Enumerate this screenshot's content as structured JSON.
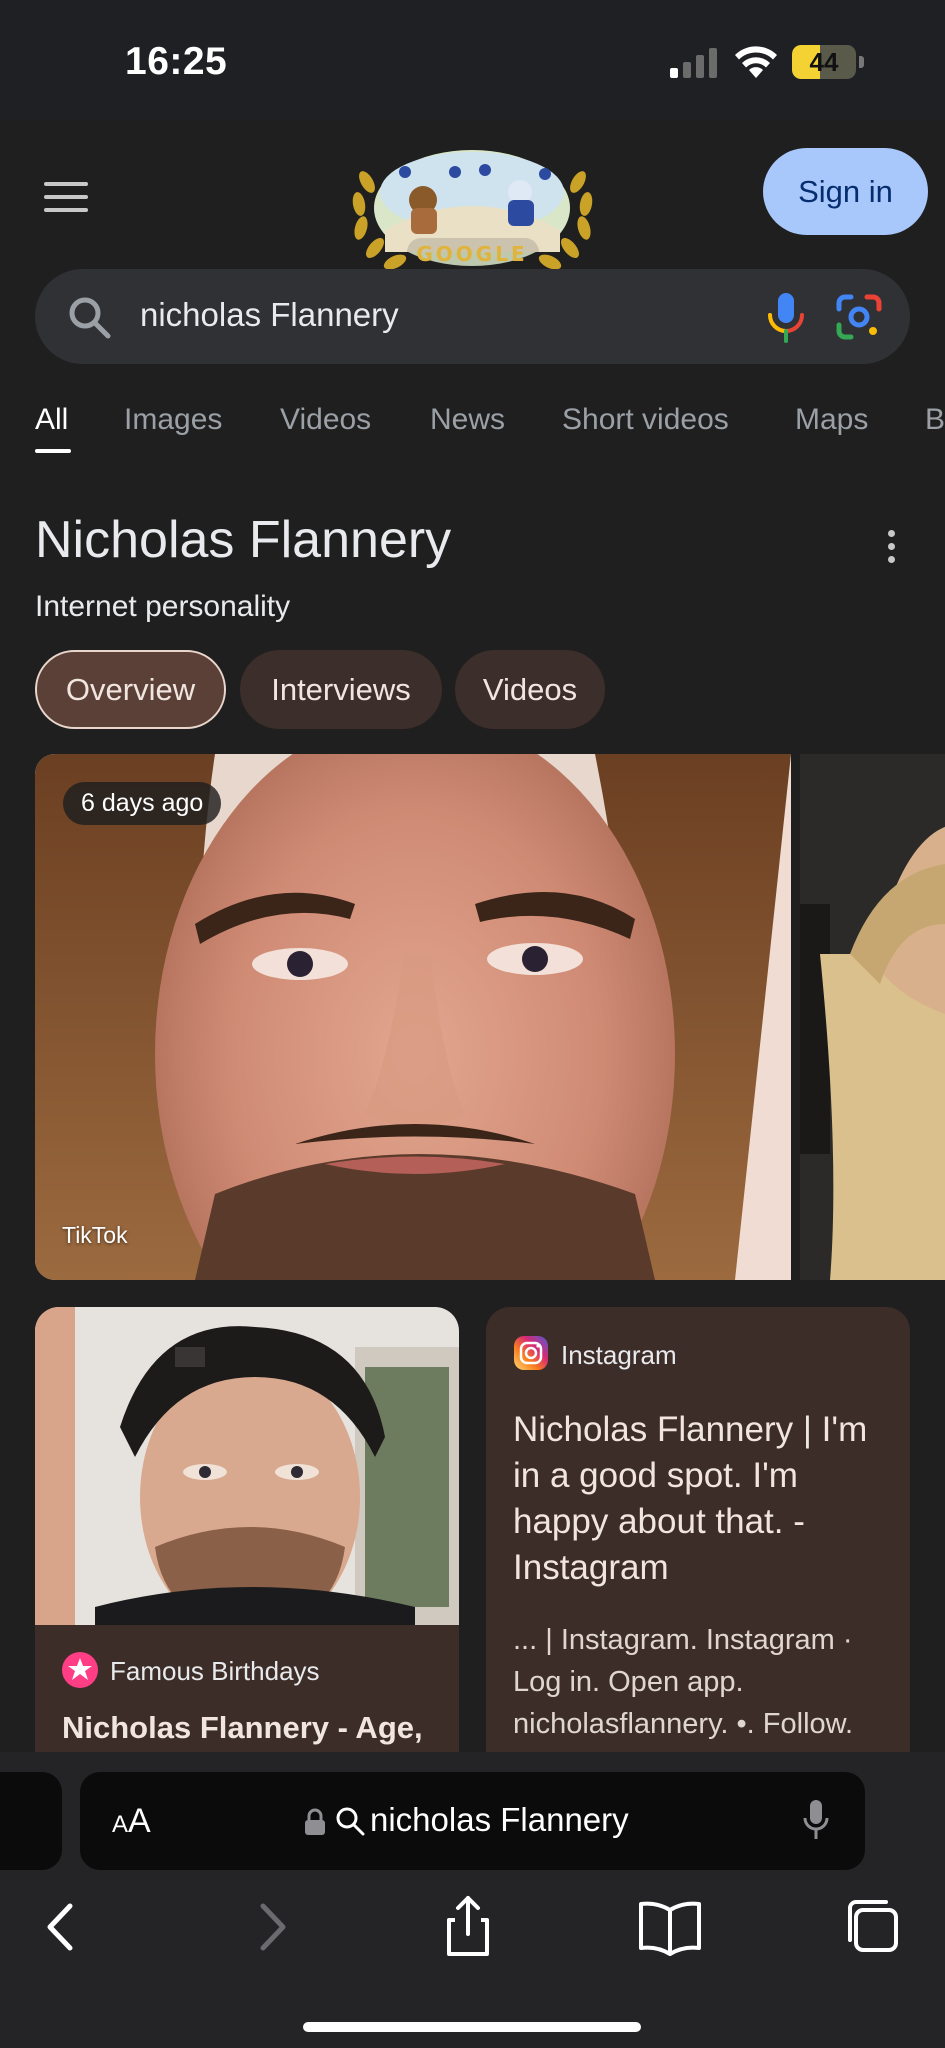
{
  "status_bar": {
    "time": "16:25",
    "battery_percent": "44",
    "battery_level": 0.44
  },
  "header": {
    "menu_icon": "hamburger-menu-icon",
    "doodle_text": "GOOGLE",
    "sign_in_label": "Sign in"
  },
  "search": {
    "query": "nicholas Flannery",
    "icons": [
      "search-icon",
      "mic-icon",
      "lens-icon"
    ]
  },
  "tabs": [
    {
      "label": "All",
      "active": true
    },
    {
      "label": "Images"
    },
    {
      "label": "Videos"
    },
    {
      "label": "News"
    },
    {
      "label": "Short videos"
    },
    {
      "label": "Maps"
    },
    {
      "label": "B"
    }
  ],
  "knowledge_panel": {
    "title": "Nicholas Flannery",
    "subtitle": "Internet personality",
    "chips": [
      {
        "label": "Overview",
        "active": true
      },
      {
        "label": "Interviews"
      },
      {
        "label": "Videos"
      }
    ]
  },
  "carousel": {
    "main_badge": "6 days ago",
    "main_source": "TikTok"
  },
  "cards": {
    "left": {
      "source": "Famous Birthdays",
      "title": "Nicholas Flannery - Age,"
    },
    "right": {
      "source": "Instagram",
      "title": "Nicholas Flannery | I'm in a good spot. I'm happy about that. - Instagram",
      "snippet": "... | Instagram. Instagram · Log in. Open app. nicholasflannery. •. Follow."
    }
  },
  "browser": {
    "aa_small": "A",
    "aa_large": "A",
    "url_text": "nicholas Flannery",
    "nav_icons": [
      "back-icon",
      "forward-icon",
      "share-icon",
      "bookmarks-icon",
      "tabs-icon"
    ]
  },
  "colors": {
    "background": "#1f1f1f",
    "search_bg": "#303134",
    "sign_in_bg": "#a8c7fa",
    "chip_bg": "#3c2e2a",
    "card_bg": "#3d2d28"
  }
}
